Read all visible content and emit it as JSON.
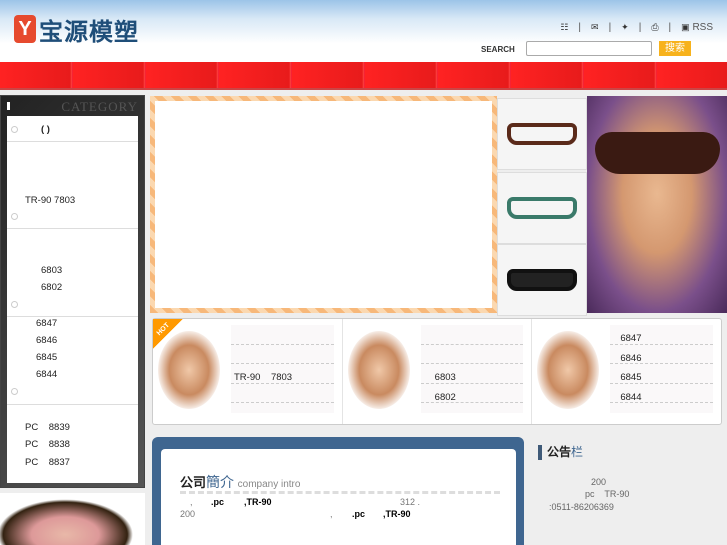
{
  "header": {
    "logo_mark": "Y",
    "logo_text": "宝源模塑",
    "links": [
      {
        "icon": "sitemap-icon",
        "label": ""
      },
      {
        "icon": "mail-icon",
        "label": ""
      },
      {
        "icon": "bookmark-icon",
        "label": ""
      },
      {
        "icon": "print-icon",
        "label": ""
      },
      {
        "icon": "rss-icon",
        "label": "RSS"
      }
    ],
    "search_label": "SEARCH",
    "search_value": "",
    "search_button": "搜索"
  },
  "sidebar": {
    "title": "CATEGORY",
    "groups": [
      {
        "items": [
          "(      )"
        ]
      },
      {
        "items": [
          "TR-90    7803"
        ]
      },
      {
        "items": [
          "6803",
          "6802"
        ]
      },
      {
        "items": [
          "6847",
          "6846",
          "6845",
          "6844"
        ]
      },
      {
        "items": [
          "PC    8839",
          "PC    8838",
          "PC    8837"
        ]
      }
    ]
  },
  "cards": [
    {
      "badge": "HOT",
      "lines": [
        "",
        "",
        "TR-90    7803",
        ""
      ]
    },
    {
      "lines": [
        "",
        "",
        "6803",
        "6802"
      ]
    },
    {
      "lines": [
        "6847",
        "6846",
        "6845",
        "6844"
      ]
    }
  ],
  "intro": {
    "title_a": "公司",
    "title_b": "簡介",
    "title_en": "company intro",
    "l1a": ",",
    "l1b": ".pc",
    ",l1c": "",
    "pc1": ",TR-90",
    "num312": "312 .",
    "n200": "200",
    "l2a": ",",
    "pc2": ".pc",
    "tr2": ",TR-90",
    "c1": ","
  },
  "notice": {
    "title_a": "公告",
    "title_b": "栏",
    "l1": "200",
    "l2": "pc    TR-90",
    "l3": ":0511-86206369"
  }
}
